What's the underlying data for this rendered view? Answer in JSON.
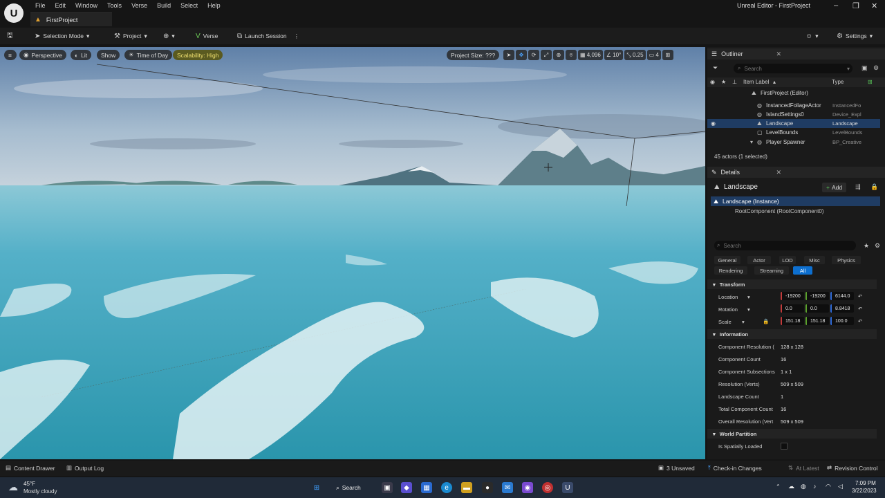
{
  "menubar": {
    "logo": "U",
    "items": [
      "File",
      "Edit",
      "Window",
      "Tools",
      "Verse",
      "Build",
      "Select",
      "Help"
    ],
    "window_title": "Unreal Editor - FirstProject",
    "project_tab": "FirstProject"
  },
  "toolbar": {
    "selection_mode": "Selection Mode",
    "project": "Project",
    "verse": "Verse",
    "launch_session": "Launch Session",
    "settings": "Settings"
  },
  "viewport": {
    "perspective": "Perspective",
    "lit": "Lit",
    "show": "Show",
    "time_of_day": "Time of Day",
    "scalability": "Scalability: High",
    "project_size": "Project Size: ???",
    "grid_value": "4,096",
    "angle_value": "10°",
    "scale_value": "0.25",
    "camera_speed": "4"
  },
  "outliner": {
    "tab": "Outliner",
    "search_placeholder": "Search",
    "col_label": "Item Label",
    "col_type": "Type",
    "rows": [
      {
        "label": "FirstProject (Editor)",
        "type": ""
      },
      {
        "label": "InstancedFoliageActor",
        "type": "InstancedFo"
      },
      {
        "label": "IslandSettings0",
        "type": "Device_Expl"
      },
      {
        "label": "Landscape",
        "type": "Landscape"
      },
      {
        "label": "LevelBounds",
        "type": "LevelBounds"
      },
      {
        "label": "Player Spawner",
        "type": "BP_Creative"
      }
    ],
    "actor_count": "45 actors (1 selected)"
  },
  "details": {
    "tab": "Details",
    "title": "Landscape",
    "add": "Add",
    "instance": "Landscape (Instance)",
    "root": "RootComponent (RootComponent0)",
    "search_placeholder": "Search",
    "filters": [
      "General",
      "Actor",
      "LOD",
      "Misc",
      "Physics",
      "Rendering",
      "Streaming",
      "All"
    ],
    "transform_header": "Transform",
    "location_label": "Location",
    "rotation_label": "Rotation",
    "scale_label": "Scale",
    "location": [
      "-19200",
      "-19200",
      "6144.0"
    ],
    "rotation": [
      "0.0",
      "0.0",
      "8.8418"
    ],
    "scale": [
      "151.18",
      "151.18",
      "100.0"
    ],
    "information_header": "Information",
    "info": [
      {
        "k": "Component Resolution (",
        "v": "128 x 128"
      },
      {
        "k": "Component Count",
        "v": "16"
      },
      {
        "k": "Component Subsections",
        "v": "1 x 1"
      },
      {
        "k": "Resolution (Verts)",
        "v": "509 x 509"
      },
      {
        "k": "Landscape Count",
        "v": "1"
      },
      {
        "k": "Total Component Count",
        "v": "16"
      },
      {
        "k": "Overall Resolution (Vert",
        "v": "509 x 509"
      }
    ],
    "world_partition_header": "World Partition",
    "spatially_loaded": "Is Spatially Loaded"
  },
  "statusbar": {
    "content_drawer": "Content Drawer",
    "output_log": "Output Log",
    "unsaved": "3 Unsaved",
    "check_in": "Check-in Changes",
    "at_latest": "At Latest",
    "revision_control": "Revision Control"
  },
  "taskbar": {
    "weather_temp": "45°F",
    "weather_desc": "Mostly cloudy",
    "search": "Search",
    "time": "7:09 PM",
    "date": "3/22/2023"
  },
  "colors": {
    "accent": "#0d6fcf",
    "selection": "#1f3c63",
    "scalability": "#f0e070"
  }
}
